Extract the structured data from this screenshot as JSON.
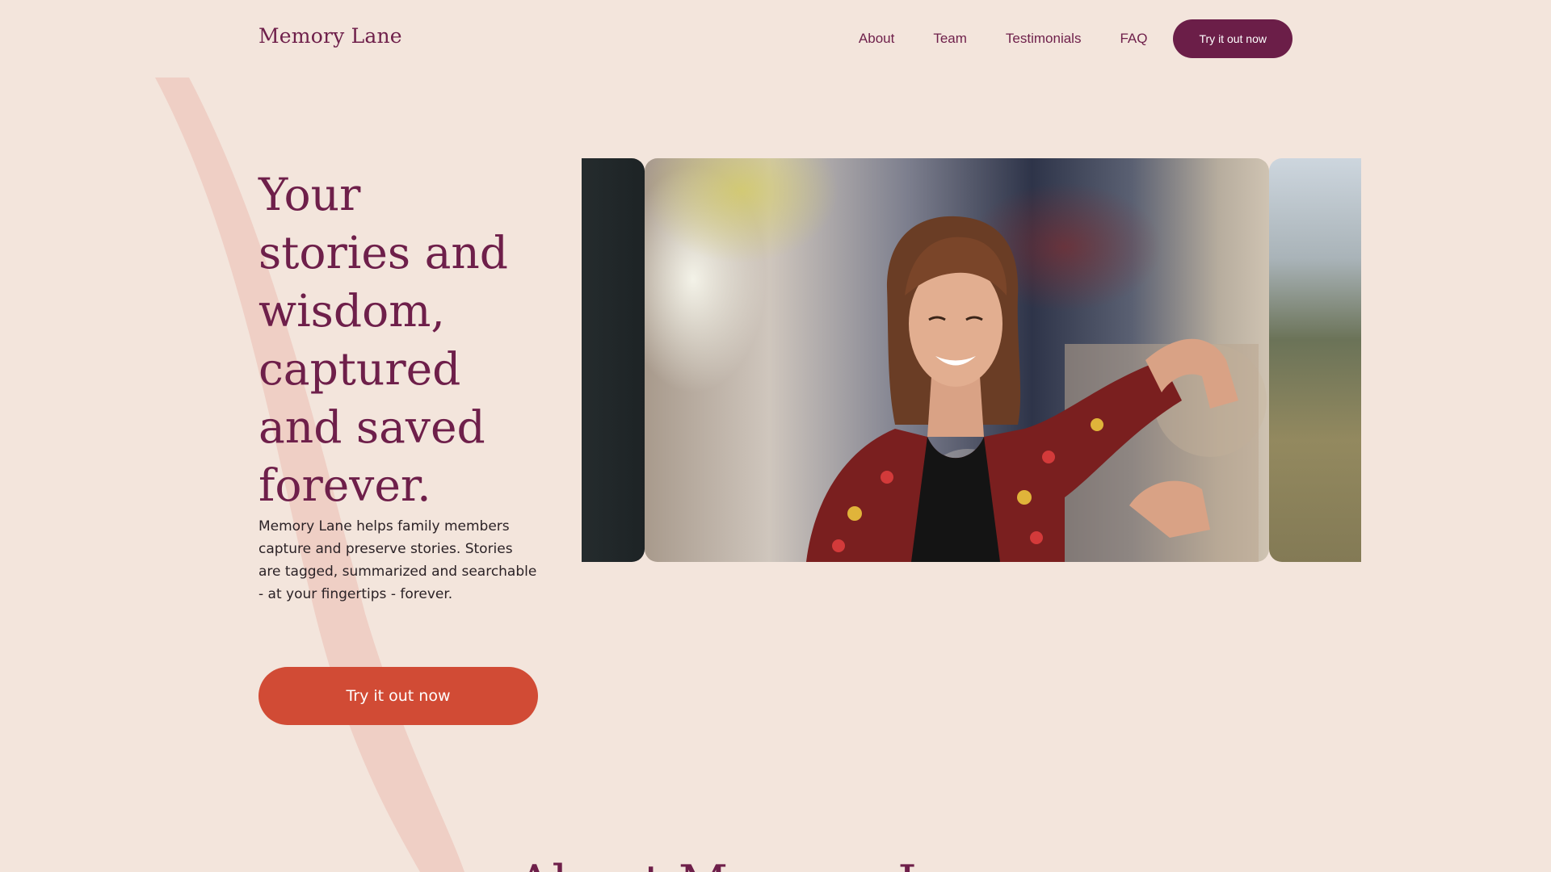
{
  "header": {
    "logo": "Memory Lane",
    "nav": [
      {
        "label": "About"
      },
      {
        "label": "Team"
      },
      {
        "label": "Testimonials"
      },
      {
        "label": "FAQ"
      }
    ],
    "cta_label": "Try it out now"
  },
  "hero": {
    "title": "Your stories and wisdom, captured and saved forever.",
    "description": "Memory Lane helps family members capture and preserve stories. Stories are tagged, summarized and searchable - at your fingertips - forever.",
    "cta_label": "Try it out now"
  },
  "carousel": {
    "slides": [
      {
        "name": "previous-photo"
      },
      {
        "name": "smiling-woman-photo"
      },
      {
        "name": "next-photo"
      }
    ]
  },
  "next_section": {
    "heading": "About Memory Lane"
  },
  "colors": {
    "background": "#f3e5dc",
    "brand_plum": "#6e1f4a",
    "accent_red": "#d14b35",
    "swoosh": "#efcfc5"
  }
}
